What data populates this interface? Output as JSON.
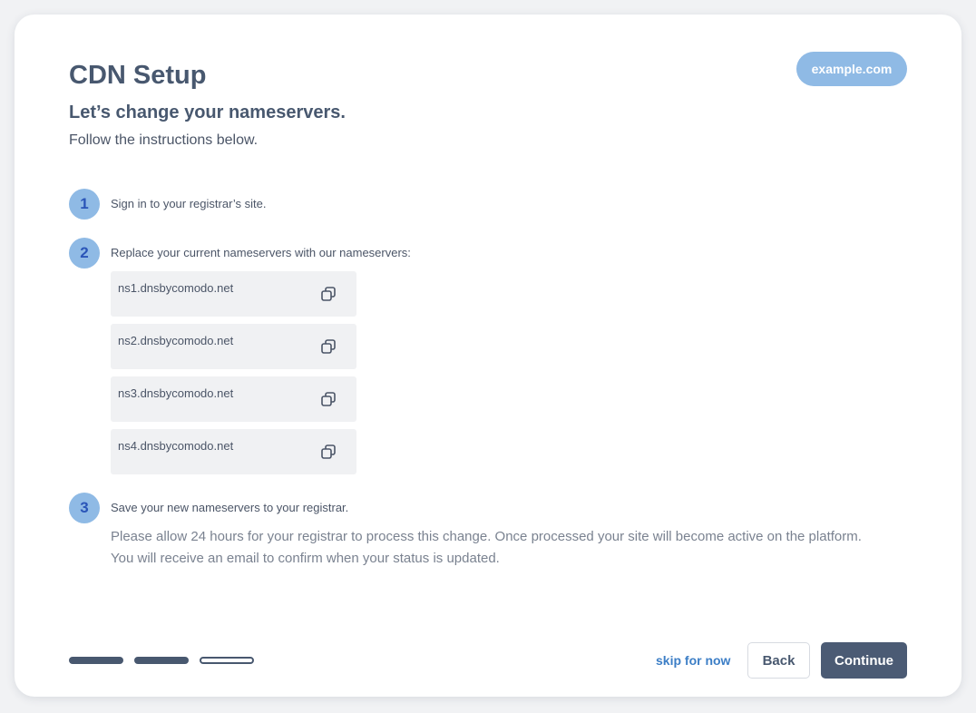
{
  "header": {
    "title": "CDN Setup",
    "domain": "example.com",
    "subtitle": "Let’s change your nameservers.",
    "instructions": "Follow the instructions below."
  },
  "steps": [
    {
      "number": "1",
      "text": "Sign in to your registrar’s site."
    },
    {
      "number": "2",
      "text": "Replace your current nameservers with our nameservers:"
    },
    {
      "number": "3",
      "text": "Save your new nameservers to your registrar."
    }
  ],
  "nameservers": [
    "ns1.dnsbycomodo.net",
    "ns2.dnsbycomodo.net",
    "ns3.dnsbycomodo.net",
    "ns4.dnsbycomodo.net"
  ],
  "note": {
    "line1": "Please allow 24 hours for your registrar to process this change. Once processed your site will become active on the platform.",
    "line2": "You will receive an email to confirm when your status is updated."
  },
  "progress": {
    "completed": 2,
    "total": 3
  },
  "footer": {
    "skip_label": "skip for now",
    "back_label": "Back",
    "continue_label": "Continue"
  },
  "colors": {
    "accent_light": "#8fbae5",
    "primary_dark": "#4b5b74",
    "link": "#3c7ec6"
  },
  "icons": {
    "copy": "copy-icon"
  }
}
